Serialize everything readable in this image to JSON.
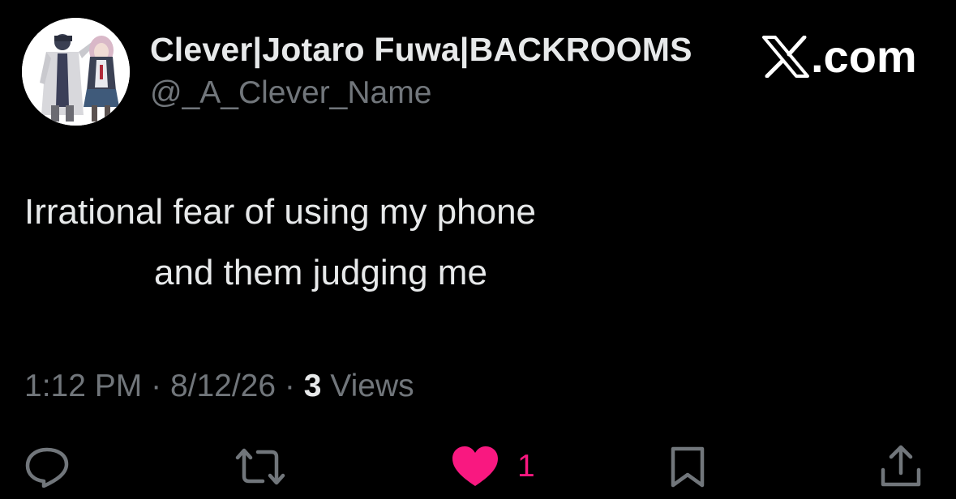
{
  "author": {
    "display_name": "Clever|Jotaro Fuwa|BACKROOMS",
    "handle": "@_A_Clever_Name"
  },
  "brand": {
    "text": ".com",
    "icon": "x-logo-icon"
  },
  "tweet": {
    "lines": [
      "Irrational fear of using my phone",
      "and them judging me"
    ]
  },
  "meta": {
    "time": "1:12 PM",
    "separator": "·",
    "date": "8/12/26",
    "views_count": "3",
    "views_label": "Views"
  },
  "actions": {
    "reply_icon": "reply-icon",
    "repost_icon": "repost-icon",
    "like_icon": "heart-icon",
    "like_count": "1",
    "bookmark_icon": "bookmark-icon",
    "share_icon": "share-icon"
  },
  "colors": {
    "background": "#000000",
    "primary_text": "#e7e9ea",
    "secondary_text": "#71767b",
    "like": "#f91880"
  }
}
